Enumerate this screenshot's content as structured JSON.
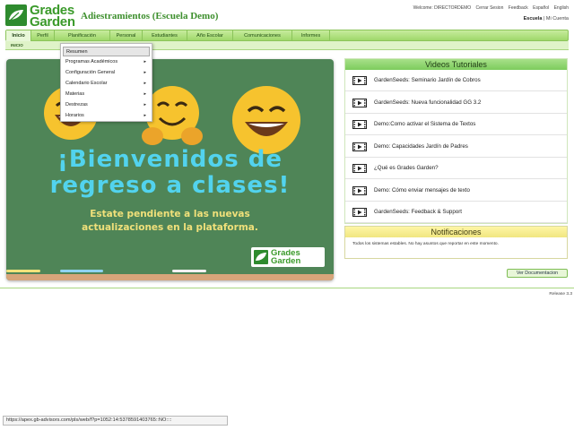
{
  "header": {
    "logo_line1": "Grades",
    "logo_line2": "Garden",
    "title": "Adiestramientos (Escuela Demo)",
    "links": [
      "Welcome: DIRECTORDEMO",
      "Cerrar Sesion",
      "Feedback",
      "Español",
      "English"
    ],
    "school_label": "Escuela",
    "account_link": "Mi Cuenta"
  },
  "nav": {
    "items": [
      "Inicio",
      "Perfil",
      "Planificación",
      "Personal",
      "Estudiantes",
      "Año Escolar",
      "Comunicaciones",
      "Informes"
    ],
    "active": "Inicio",
    "breadcrumb": "INICIO"
  },
  "dropdown": {
    "items": [
      {
        "label": "Resumen",
        "submenu": false
      },
      {
        "label": "Programas Académicos",
        "submenu": true
      },
      {
        "label": "Configuración General",
        "submenu": true
      },
      {
        "label": "Calendario Escolar",
        "submenu": true
      },
      {
        "label": "Materias",
        "submenu": true
      },
      {
        "label": "Destrezas",
        "submenu": true
      },
      {
        "label": "Horarios",
        "submenu": true
      }
    ],
    "highlighted": "Resumen"
  },
  "banner": {
    "headline_line1": "¡Bienvenidos de",
    "headline_line2": "regreso a clases!",
    "sub_line1": "Estate pendiente a las nuevas",
    "sub_line2": "actualizaciones en la plataforma.",
    "logo_line1": "Grades",
    "logo_line2": "Garden",
    "colors": {
      "board": "#4f8557",
      "headline": "#52d3ee",
      "sub": "#f0e07a"
    }
  },
  "videos": {
    "title": "Videos Tutoriales",
    "items": [
      "GardenSeeds: Seminario Jardín de Cobros",
      "GardenSeeds: Nueva funcionalidad GG 3.2",
      "Demo:Como activar el Sistema de Textos",
      "Demo: Capacidades Jardín de Padres",
      "¿Qué es Grades Garden?",
      "Demo: Cómo enviar mensajes de texto",
      "GardenSeeds: Feedback & Support"
    ],
    "icon": "film-play-icon"
  },
  "notifications": {
    "title": "Notificaciones",
    "text": "Todos los sistemas estables. No hay asuntos que reportar en este momento."
  },
  "doc_button": "Ver Documentacion",
  "release": "Release 3.3",
  "statusbar_url": "https://apex.gb-advisors.com/pls/web/f?p=1052:14:5378591403765::NO::::"
}
